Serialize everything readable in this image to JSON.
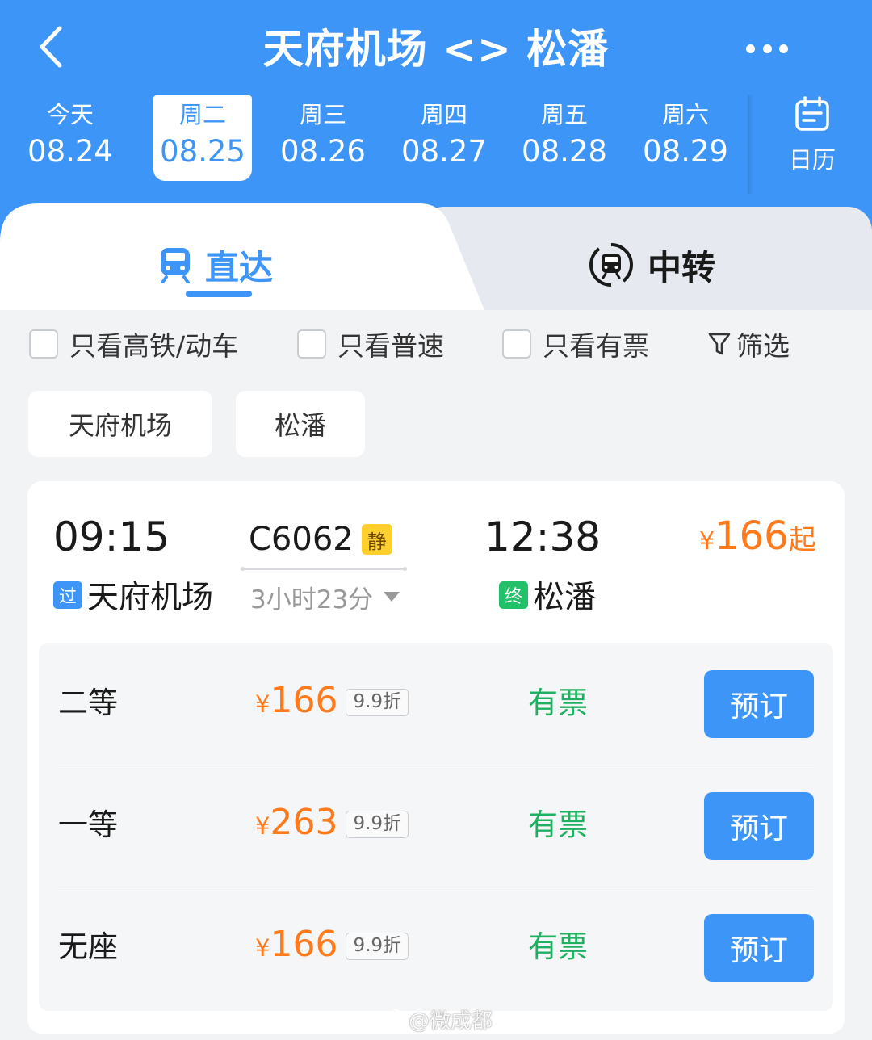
{
  "header": {
    "title": "天府机场 <> 松潘",
    "calendar_label": "日历"
  },
  "dates": [
    {
      "dow": "今天",
      "date": "08.24"
    },
    {
      "dow": "周二",
      "date": "08.25",
      "active": true
    },
    {
      "dow": "周三",
      "date": "08.26"
    },
    {
      "dow": "周四",
      "date": "08.27"
    },
    {
      "dow": "周五",
      "date": "08.28"
    },
    {
      "dow": "周六",
      "date": "08.29"
    }
  ],
  "tabs": {
    "direct": "直达",
    "transfer": "中转"
  },
  "filters": {
    "hsr_only": "只看高铁/动车",
    "normal_only": "只看普速",
    "available_only": "只看有票",
    "filter": "筛选"
  },
  "station_chips": {
    "from": "天府机场",
    "to": "松潘"
  },
  "train": {
    "depart_time": "09:15",
    "depart_tag": "过",
    "depart_station": "天府机场",
    "number": "C6062",
    "quiet_badge": "静",
    "duration": "3小时23分",
    "arrive_time": "12:38",
    "arrive_tag": "终",
    "arrive_station": "松潘",
    "min_price_currency": "¥",
    "min_price": "166",
    "min_price_suffix": "起",
    "seats": [
      {
        "name": "二等",
        "currency": "¥",
        "price": "166",
        "discount": "9.9折",
        "status": "有票",
        "button": "预订"
      },
      {
        "name": "一等",
        "currency": "¥",
        "price": "263",
        "discount": "9.9折",
        "status": "有票",
        "button": "预订"
      },
      {
        "name": "无座",
        "currency": "¥",
        "price": "166",
        "discount": "9.9折",
        "status": "有票",
        "button": "预订"
      }
    ]
  },
  "watermark": "@微成都",
  "colors": {
    "primary": "#3d96f7",
    "price": "#ff7a1a",
    "available": "#1fb161",
    "quiet_badge": "#ffcf2e"
  }
}
